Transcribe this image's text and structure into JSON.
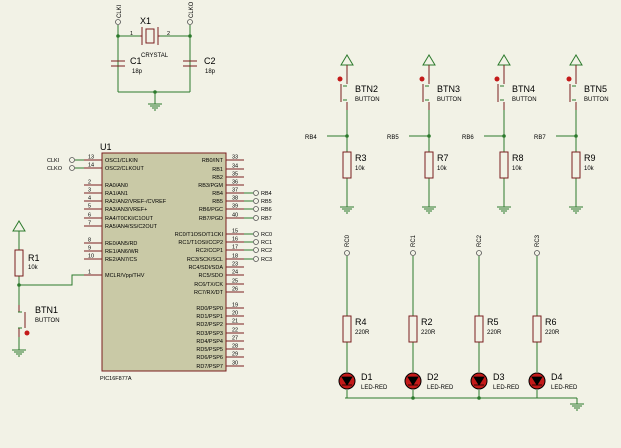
{
  "crystal": {
    "ref": "X1",
    "value": "CRYSTAL",
    "pin1": "1",
    "pin2": "2",
    "net_left": "CLKI",
    "net_right": "CLKO"
  },
  "caps": [
    {
      "ref": "C1",
      "value": "18p"
    },
    {
      "ref": "C2",
      "value": "18p"
    }
  ],
  "mcu": {
    "ref": "U1",
    "part": "PIC16F877A",
    "left_pins": [
      {
        "num": "13",
        "name": "OSC1/CLKIN",
        "net": "CLKI"
      },
      {
        "num": "14",
        "name": "OSC2/CLKOUT",
        "net": "CLKO"
      },
      {
        "num": "2",
        "name": "RA0/AN0"
      },
      {
        "num": "3",
        "name": "RA1/AN1"
      },
      {
        "num": "4",
        "name": "RA2/AN2/VREF-/CVREF"
      },
      {
        "num": "5",
        "name": "RA3/AN3/VREF+"
      },
      {
        "num": "6",
        "name": "RA4/T0CKI/C1OUT"
      },
      {
        "num": "7",
        "name": "RA5/AN4/SS/C2OUT"
      },
      {
        "num": "8",
        "name": "RE0/AN5/RD"
      },
      {
        "num": "9",
        "name": "RE1/AN6/WR"
      },
      {
        "num": "10",
        "name": "RE2/AN7/CS"
      },
      {
        "num": "1",
        "name": "MCLR/Vpp/THV"
      }
    ],
    "right_pins": [
      {
        "num": "33",
        "name": "RB0/INT"
      },
      {
        "num": "34",
        "name": "RB1"
      },
      {
        "num": "35",
        "name": "RB2"
      },
      {
        "num": "36",
        "name": "RB3/PGM"
      },
      {
        "num": "37",
        "name": "RB4",
        "net": "RB4"
      },
      {
        "num": "38",
        "name": "RB5",
        "net": "RB5"
      },
      {
        "num": "39",
        "name": "RB6/PGC",
        "net": "RB6"
      },
      {
        "num": "40",
        "name": "RB7/PGD",
        "net": "RB7"
      },
      {
        "num": "15",
        "name": "RC0/T1OSO/T1CKI",
        "net": "RC0"
      },
      {
        "num": "16",
        "name": "RC1/T1OSI/CCP2",
        "net": "RC1"
      },
      {
        "num": "17",
        "name": "RC2/CCP1",
        "net": "RC2"
      },
      {
        "num": "18",
        "name": "RC3/SCK/SCL",
        "net": "RC3"
      },
      {
        "num": "23",
        "name": "RC4/SDI/SDA"
      },
      {
        "num": "24",
        "name": "RC5/SDO"
      },
      {
        "num": "25",
        "name": "RC6/TX/CK"
      },
      {
        "num": "26",
        "name": "RC7/RX/DT"
      },
      {
        "num": "19",
        "name": "RD0/PSP0"
      },
      {
        "num": "20",
        "name": "RD1/PSP1"
      },
      {
        "num": "21",
        "name": "RD2/PSP2"
      },
      {
        "num": "22",
        "name": "RD3/PSP3"
      },
      {
        "num": "27",
        "name": "RD4/PSP4"
      },
      {
        "num": "28",
        "name": "RD5/PSP5"
      },
      {
        "num": "29",
        "name": "RD6/PSP6"
      },
      {
        "num": "30",
        "name": "RD7/PSP7"
      }
    ]
  },
  "reset": {
    "resistor": {
      "ref": "R1",
      "value": "10k"
    },
    "button": {
      "ref": "BTN1",
      "value": "BUTTON"
    }
  },
  "buttons": [
    {
      "ref": "BTN2",
      "value": "BUTTON",
      "net": "RB4",
      "res_ref": "R3",
      "res_value": "10k"
    },
    {
      "ref": "BTN3",
      "value": "BUTTON",
      "net": "RB5",
      "res_ref": "R7",
      "res_value": "10k"
    },
    {
      "ref": "BTN4",
      "value": "BUTTON",
      "net": "RB6",
      "res_ref": "R8",
      "res_value": "10k"
    },
    {
      "ref": "BTN5",
      "value": "BUTTON",
      "net": "RB7",
      "res_ref": "R9",
      "res_value": "10k"
    }
  ],
  "leds": [
    {
      "net": "RC0",
      "res_ref": "R4",
      "res_value": "220R",
      "ref": "D1",
      "value": "LED-RED"
    },
    {
      "net": "RC1",
      "res_ref": "R2",
      "res_value": "220R",
      "ref": "D2",
      "value": "LED-RED"
    },
    {
      "net": "RC2",
      "res_ref": "R5",
      "res_value": "220R",
      "ref": "D3",
      "value": "LED-RED"
    },
    {
      "net": "RC3",
      "res_ref": "R6",
      "res_value": "220R",
      "ref": "D4",
      "value": "LED-RED"
    }
  ],
  "colors": {
    "wire": "#2c7a2c",
    "component": "#7a1f1f",
    "chip": "#c9c9a6",
    "led": "#c41a1a",
    "background": "#f2f2e6"
  }
}
